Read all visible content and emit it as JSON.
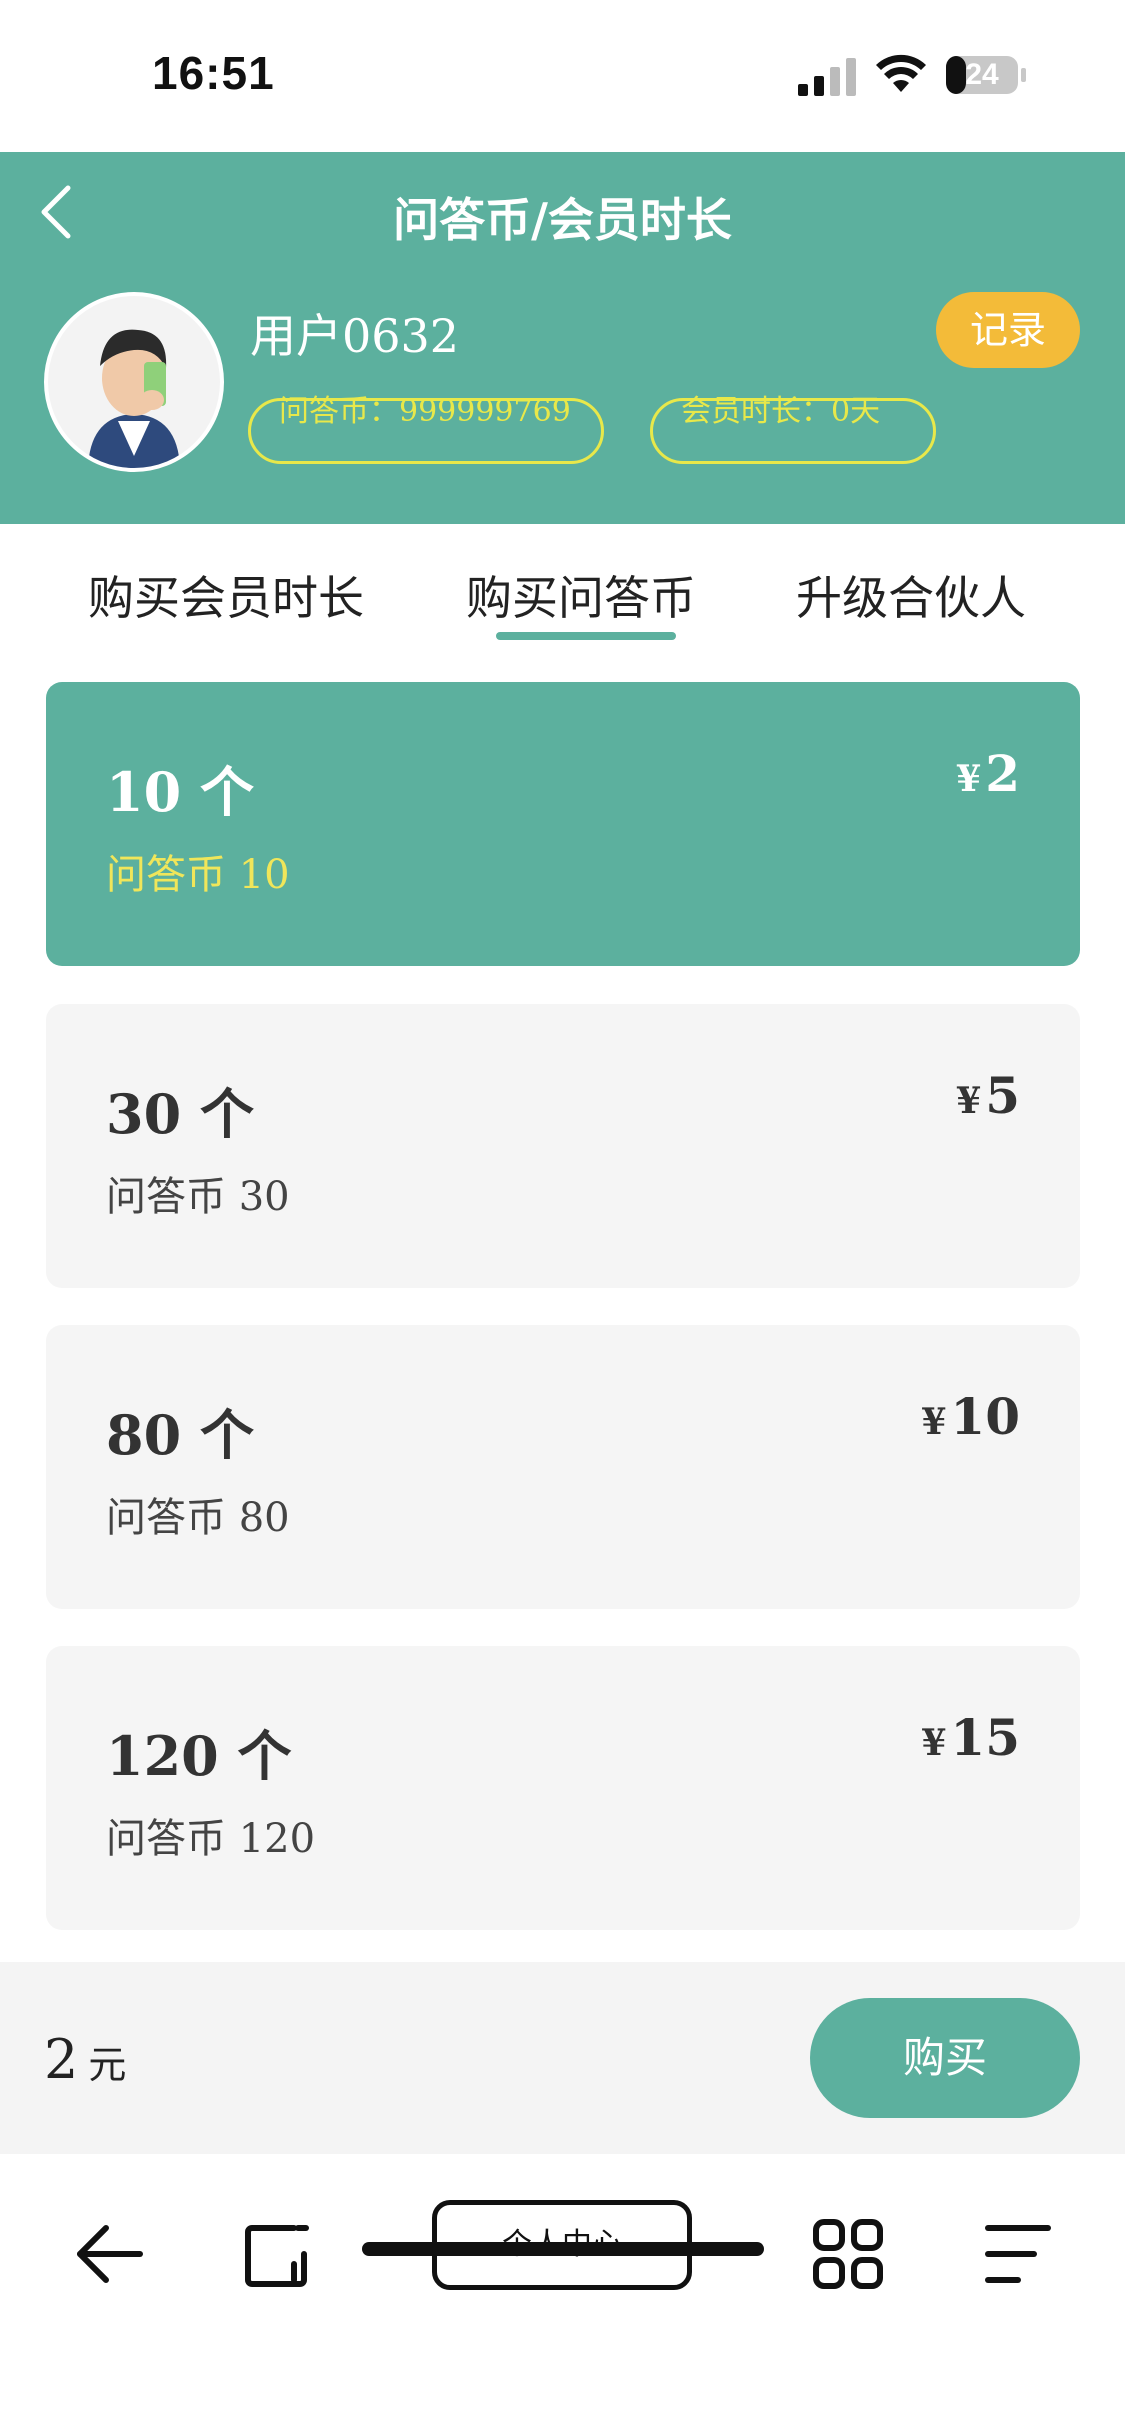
{
  "status": {
    "time": "16:51",
    "battery": "24"
  },
  "header": {
    "title": "问答币/会员时长",
    "username": "用户0632",
    "record_label": "记录",
    "coins_text": "问答币：999999769",
    "member_text": "会员时长：0天"
  },
  "tabs": [
    {
      "label": "购买会员时长"
    },
    {
      "label": "购买问答币"
    },
    {
      "label": "升级合伙人"
    }
  ],
  "active_tab": 1,
  "packages": [
    {
      "qty": "10 个",
      "desc": "问答币 10",
      "currency": "¥",
      "price": "2",
      "selected": true
    },
    {
      "qty": "30 个",
      "desc": "问答币 30",
      "currency": "¥",
      "price": "5",
      "selected": false
    },
    {
      "qty": "80 个",
      "desc": "问答币 80",
      "currency": "¥",
      "price": "10",
      "selected": false
    },
    {
      "qty": "120 个",
      "desc": "问答币 120",
      "currency": "¥",
      "price": "15",
      "selected": false
    }
  ],
  "purchase": {
    "amount": "2",
    "unit": "元",
    "button_label": "购买"
  },
  "toolbar": {
    "center_label": "个人中心"
  },
  "colors": {
    "primary": "#5cb09e",
    "accent": "#f3bb39",
    "highlight": "#e8e84a"
  },
  "icons": [
    "back-icon",
    "signal-icon",
    "wifi-icon",
    "battery-icon",
    "avatar",
    "arrow-left-icon",
    "tabs-icon",
    "grid-icon",
    "menu-icon"
  ]
}
